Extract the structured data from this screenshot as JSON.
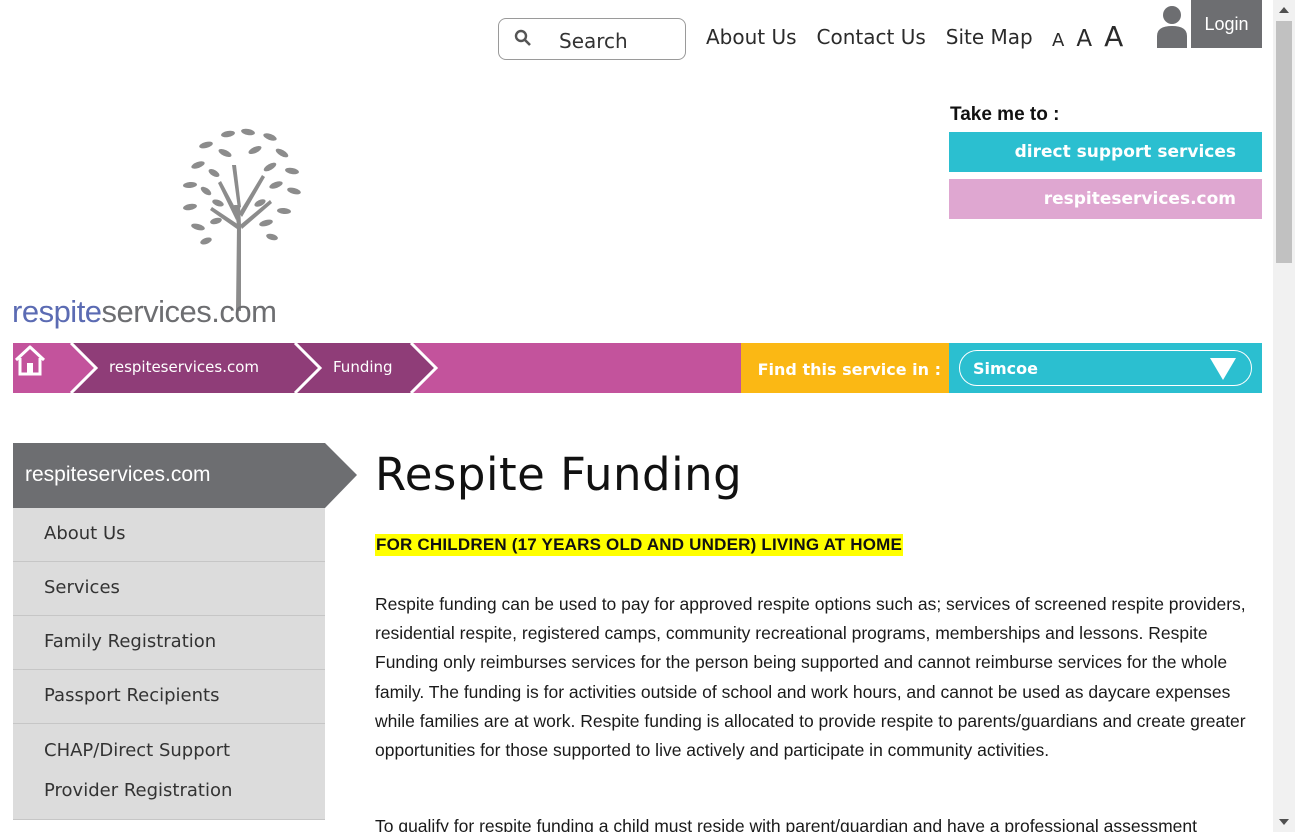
{
  "header": {
    "search_placeholder": "Search",
    "links": [
      "About Us",
      "Contact Us",
      "Site Map"
    ],
    "font_sizes": [
      "A",
      "A",
      "A"
    ],
    "login_label": "Login"
  },
  "logo": {
    "part1": "respite",
    "part2": "services.com"
  },
  "take_me_to": {
    "label": "Take me to :",
    "buttons": [
      "direct support services",
      "respiteservices.com"
    ]
  },
  "breadcrumb": {
    "items": [
      "respiteservices.com",
      "Funding"
    ],
    "find_label": "Find this service in :",
    "region_selected": "Simcoe"
  },
  "sidebar": {
    "heading": "respiteservices.com",
    "items": [
      "About Us",
      "Services",
      "Family Registration",
      "Passport Recipients",
      "CHAP/Direct Support Provider Registration"
    ]
  },
  "main": {
    "title": "Respite Funding",
    "highlight": "FOR CHILDREN (17 YEARS OLD AND UNDER) LIVING AT HOME",
    "paragraph1": "Respite funding can be used to pay for approved respite options such as; services of screened respite providers, residential respite, registered camps, community recreational programs, memberships and lessons. Respite Funding only reimburses services for the person being supported and cannot reimburse services for the whole family. The funding is for activities outside of school and work hours, and cannot be used as daycare expenses while families are at work. Respite funding is allocated to provide respite to parents/guardians and create greater opportunities for those supported to live actively and participate in community activities.",
    "paragraph2": "To qualify for respite funding a child must reside with parent/guardian and have a professional assessment"
  },
  "colors": {
    "magenta": "#c3539c",
    "magenta_dark": "#8f3d78",
    "cyan": "#2bbfd0",
    "pink": "#dfa7d1",
    "yellow": "#fbb814",
    "gray": "#6d6e71",
    "logo_blue": "#5b6bb3"
  }
}
